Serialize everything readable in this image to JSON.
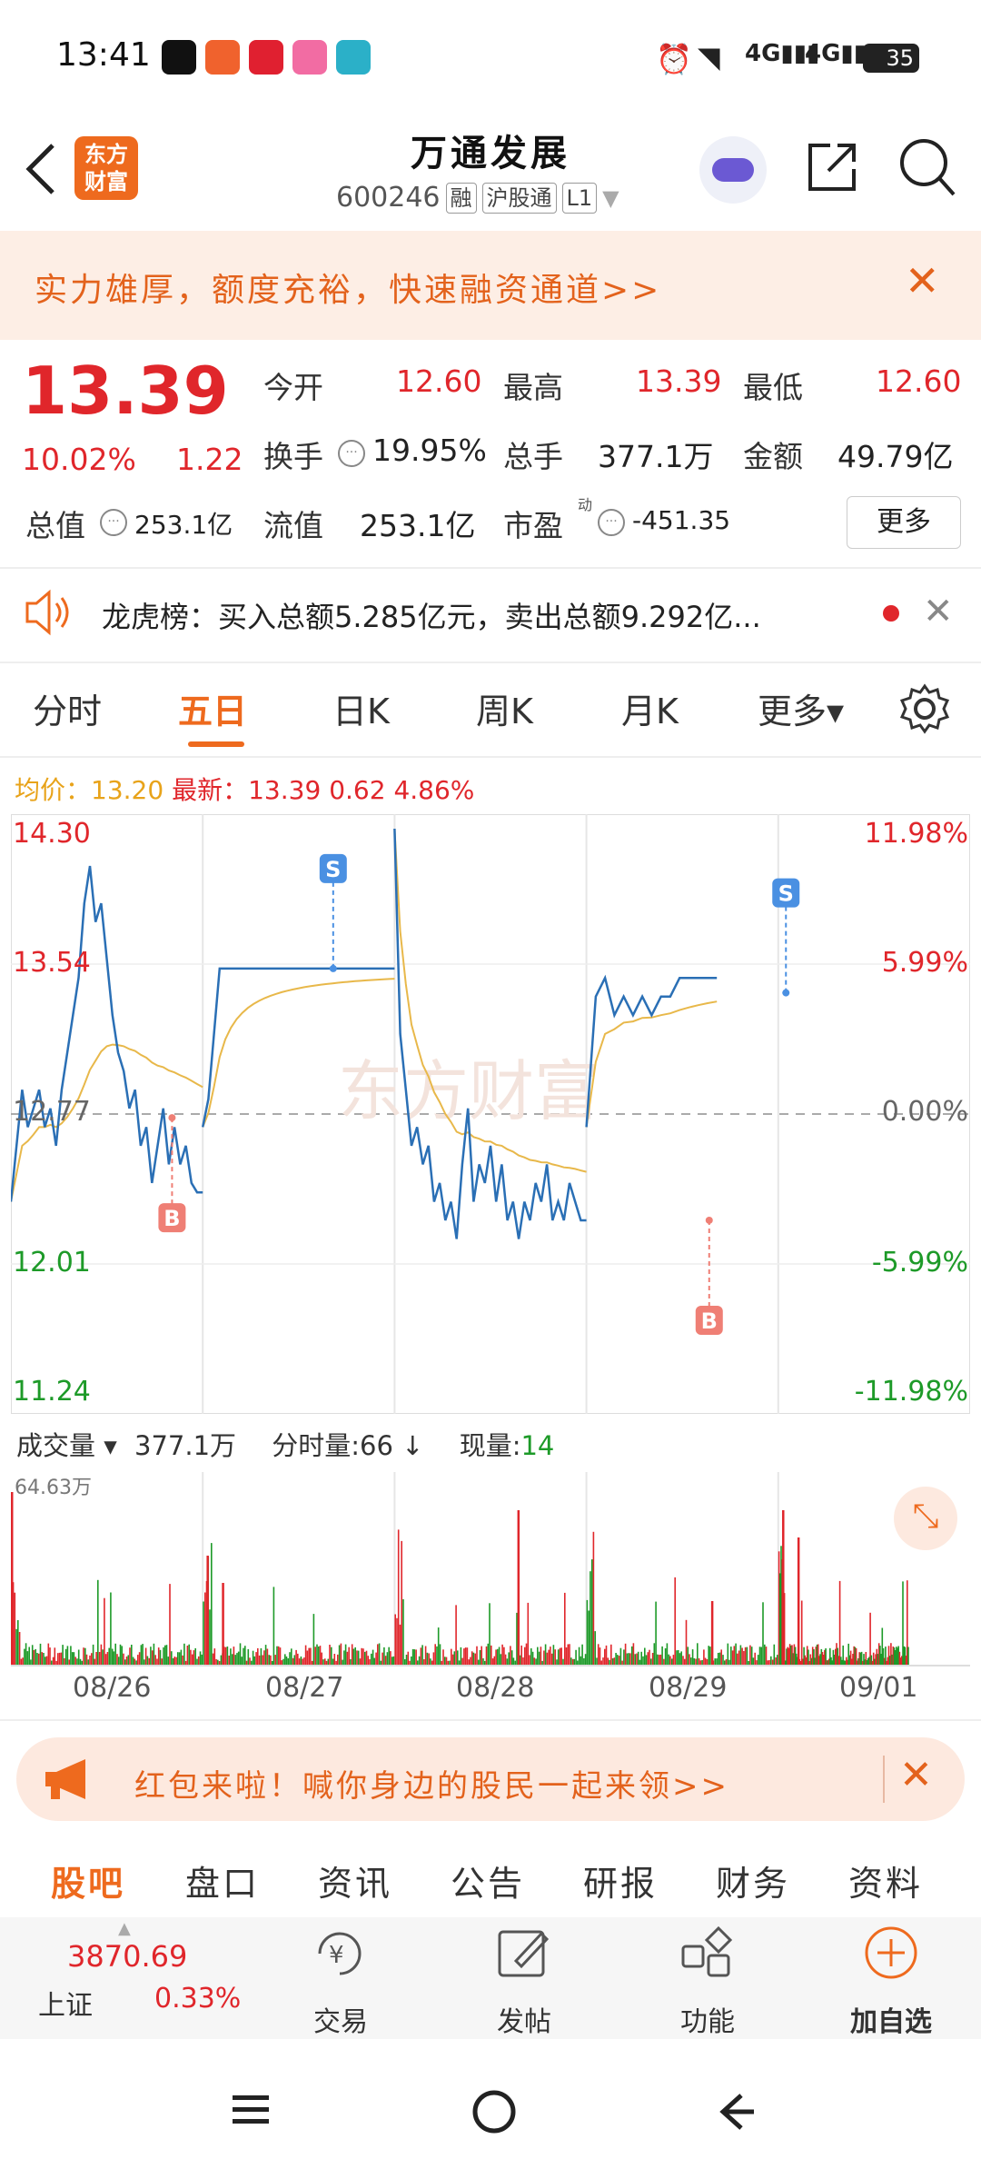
{
  "status_bar": {
    "time": "13:41",
    "battery": "35"
  },
  "header": {
    "logo_text_line1": "东方",
    "logo_text_line2": "财富",
    "title": "万通发展",
    "code": "600246",
    "tags": [
      "融",
      "沪股通",
      "L1"
    ]
  },
  "banner": {
    "text": "实力雄厚，额度充裕，快速融资通道>>"
  },
  "quote": {
    "price": "13.39",
    "change_pct": "10.02%",
    "change": "1.22",
    "open_label": "今开",
    "open": "12.60",
    "high_label": "最高",
    "high": "13.39",
    "low_label": "最低",
    "low": "12.60",
    "turnover_label": "换手",
    "turnover": "19.95%",
    "volume_label": "总手",
    "volume": "377.1万",
    "amount_label": "金额",
    "amount": "49.79亿",
    "mktcap_label": "总值",
    "mktcap": "253.1亿",
    "float_label": "流值",
    "float_cap": "253.1亿",
    "pe_label": "市盈",
    "pe_sup": "动",
    "pe": "-451.35",
    "more_label": "更多"
  },
  "lhb": {
    "text": "龙虎榜：买入总额5.285亿元，卖出总额9.292亿..."
  },
  "tabs": [
    "分时",
    "五日",
    "日K",
    "周K",
    "月K",
    "更多▾"
  ],
  "active_tab": 1,
  "chart_info": {
    "avg_label": "均价：",
    "avg": "13.20",
    "latest_label": "最新：",
    "latest": "13.39",
    "change": "0.62",
    "change_pct": "4.86%",
    "watermark": "东方财富",
    "marker_s": "S",
    "marker_b": "B"
  },
  "chart_data": {
    "type": "line",
    "title": "",
    "x_labels": [
      "08/26",
      "08/27",
      "08/28",
      "08/29",
      "09/01"
    ],
    "y_left_ticks": [
      "14.30",
      "13.54",
      "12.77",
      "12.01",
      "11.24"
    ],
    "y_right_ticks": [
      "11.98%",
      "5.99%",
      "0.00%",
      "-5.99%",
      "-11.98%"
    ],
    "ylim": [
      11.24,
      14.3
    ],
    "prev_close": 12.77,
    "series": [
      {
        "values": [
          12.3,
          12.6,
          12.9,
          12.7,
          12.8,
          12.9,
          12.7,
          12.8,
          12.6,
          12.9,
          13.1,
          13.3,
          13.5,
          13.9,
          14.1,
          13.8,
          13.9,
          13.6,
          13.3,
          13.1,
          13.0,
          12.8,
          12.9,
          12.6,
          12.7,
          12.4,
          12.6,
          12.8,
          12.5,
          12.7,
          12.5,
          12.6,
          12.4,
          12.35,
          12.35
        ]
      },
      {
        "values": [
          12.7,
          12.85,
          13.2,
          13.55,
          13.55,
          13.55,
          13.55,
          13.55,
          13.55,
          13.55,
          13.55,
          13.55,
          13.55,
          13.55,
          13.55,
          13.55,
          13.55,
          13.55,
          13.55,
          13.55,
          13.55,
          13.55,
          13.55,
          13.55,
          13.55,
          13.55,
          13.55,
          13.55,
          13.55,
          13.55,
          13.55,
          13.55,
          13.55,
          13.55,
          13.55
        ]
      },
      {
        "values": [
          14.3,
          13.2,
          12.9,
          12.6,
          12.7,
          12.5,
          12.6,
          12.3,
          12.4,
          12.2,
          12.3,
          12.1,
          12.5,
          12.8,
          12.3,
          12.5,
          12.4,
          12.6,
          12.3,
          12.5,
          12.2,
          12.3,
          12.1,
          12.3,
          12.2,
          12.4,
          12.3,
          12.5,
          12.2,
          12.3,
          12.2,
          12.4,
          12.3,
          12.2,
          12.2
        ]
      },
      {
        "values": [
          12.7,
          13.4,
          13.5,
          13.3,
          13.4,
          13.3,
          13.4,
          13.3,
          13.4,
          13.4,
          13.5,
          13.5,
          13.5,
          13.5,
          13.5
        ]
      }
    ],
    "volume": {
      "label": "成交量",
      "total": "377.1万",
      "min_label": "分时量:66",
      "cur_label": "现量:",
      "cur": "14",
      "max": "64.63万"
    }
  },
  "promo": {
    "text": "红包来啦！喊你身边的股民一起来领>>"
  },
  "bottom_tabs": [
    "股吧",
    "盘口",
    "资讯",
    "公告",
    "研报",
    "财务",
    "资料"
  ],
  "bottom_bar": {
    "index_value": "3870.69",
    "index_name": "上证",
    "index_pct": "0.33%",
    "trade": "交易",
    "post": "发帖",
    "func": "功能",
    "add": "加自选"
  },
  "colors": {
    "accent": "#ee6a1e",
    "up": "#e0262b",
    "down": "#1d9a28",
    "price_line": "#2a6fb5",
    "avg_line": "#e8b84a"
  }
}
